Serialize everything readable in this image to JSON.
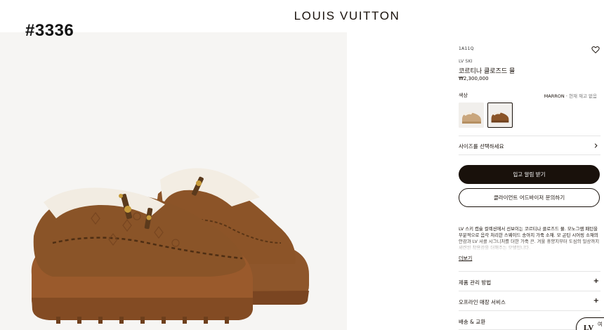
{
  "overlay": {
    "id_label": "#3336"
  },
  "header": {
    "brand": "LOUIS VUITTON"
  },
  "gallery": {
    "image_alt": "LV Ski closed mule in marron suede with shearling lining"
  },
  "product": {
    "ref": "1A11Q",
    "line": "LV SKI",
    "name": "코르티나 클로즈드 뮬",
    "price": "₩2,300,000",
    "color_label": "색상",
    "selected_color": "MARRON",
    "stock_status": "현재 재고 없음",
    "swatches": [
      "beige",
      "marron"
    ],
    "size_label": "사이즈를 선택하세요",
    "primary_button": "입고 알림 받기",
    "secondary_button": "클라이언트 어드바이저 문의하기",
    "description": "LV 스키 캡슐 컬렉션에서 선보이는 코르티나 클로즈드 뮬. 모노그램 패턴을 부분적으로 음각 처리한 스웨이드 송아지 가죽 소재. 모 곤틴 시어링 소재의 안감과 LV 서클 시그니처를 더한 가죽 끈. 겨울 휴양지부터 도심의 일상까지 세련된 착용감을 더해주는 모델입니다.",
    "more_link": "더보기",
    "accordions": [
      "제품 관리 방법",
      "오프라인 매장 서비스",
      "배송 & 교환"
    ]
  },
  "chat": {
    "badge": "LV",
    "label": "여"
  },
  "colors": {
    "accent": "#19110b",
    "shoe": "#8a5428",
    "sole": "#9a5a2c",
    "fur": "#f2ece2"
  }
}
